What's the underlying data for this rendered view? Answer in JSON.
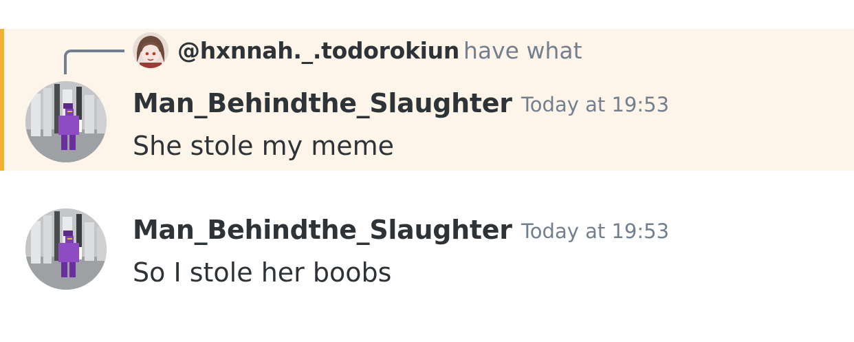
{
  "messages": [
    {
      "highlighted": true,
      "reply": {
        "mention": "@hxnnah._.todorokiun",
        "text": "have what"
      },
      "username": "Man_Behindthe_Slaughter",
      "timestamp": "Today at 19:53",
      "content": "She stole my meme"
    },
    {
      "highlighted": false,
      "username": "Man_Behindthe_Slaughter",
      "timestamp": "Today at 19:53",
      "content": "So I stole her boobs"
    }
  ],
  "colors": {
    "highlight_bg": "#fdf5e9",
    "highlight_bar": "#f0b232",
    "text_primary": "#2e3338",
    "text_muted": "#747f8d"
  }
}
